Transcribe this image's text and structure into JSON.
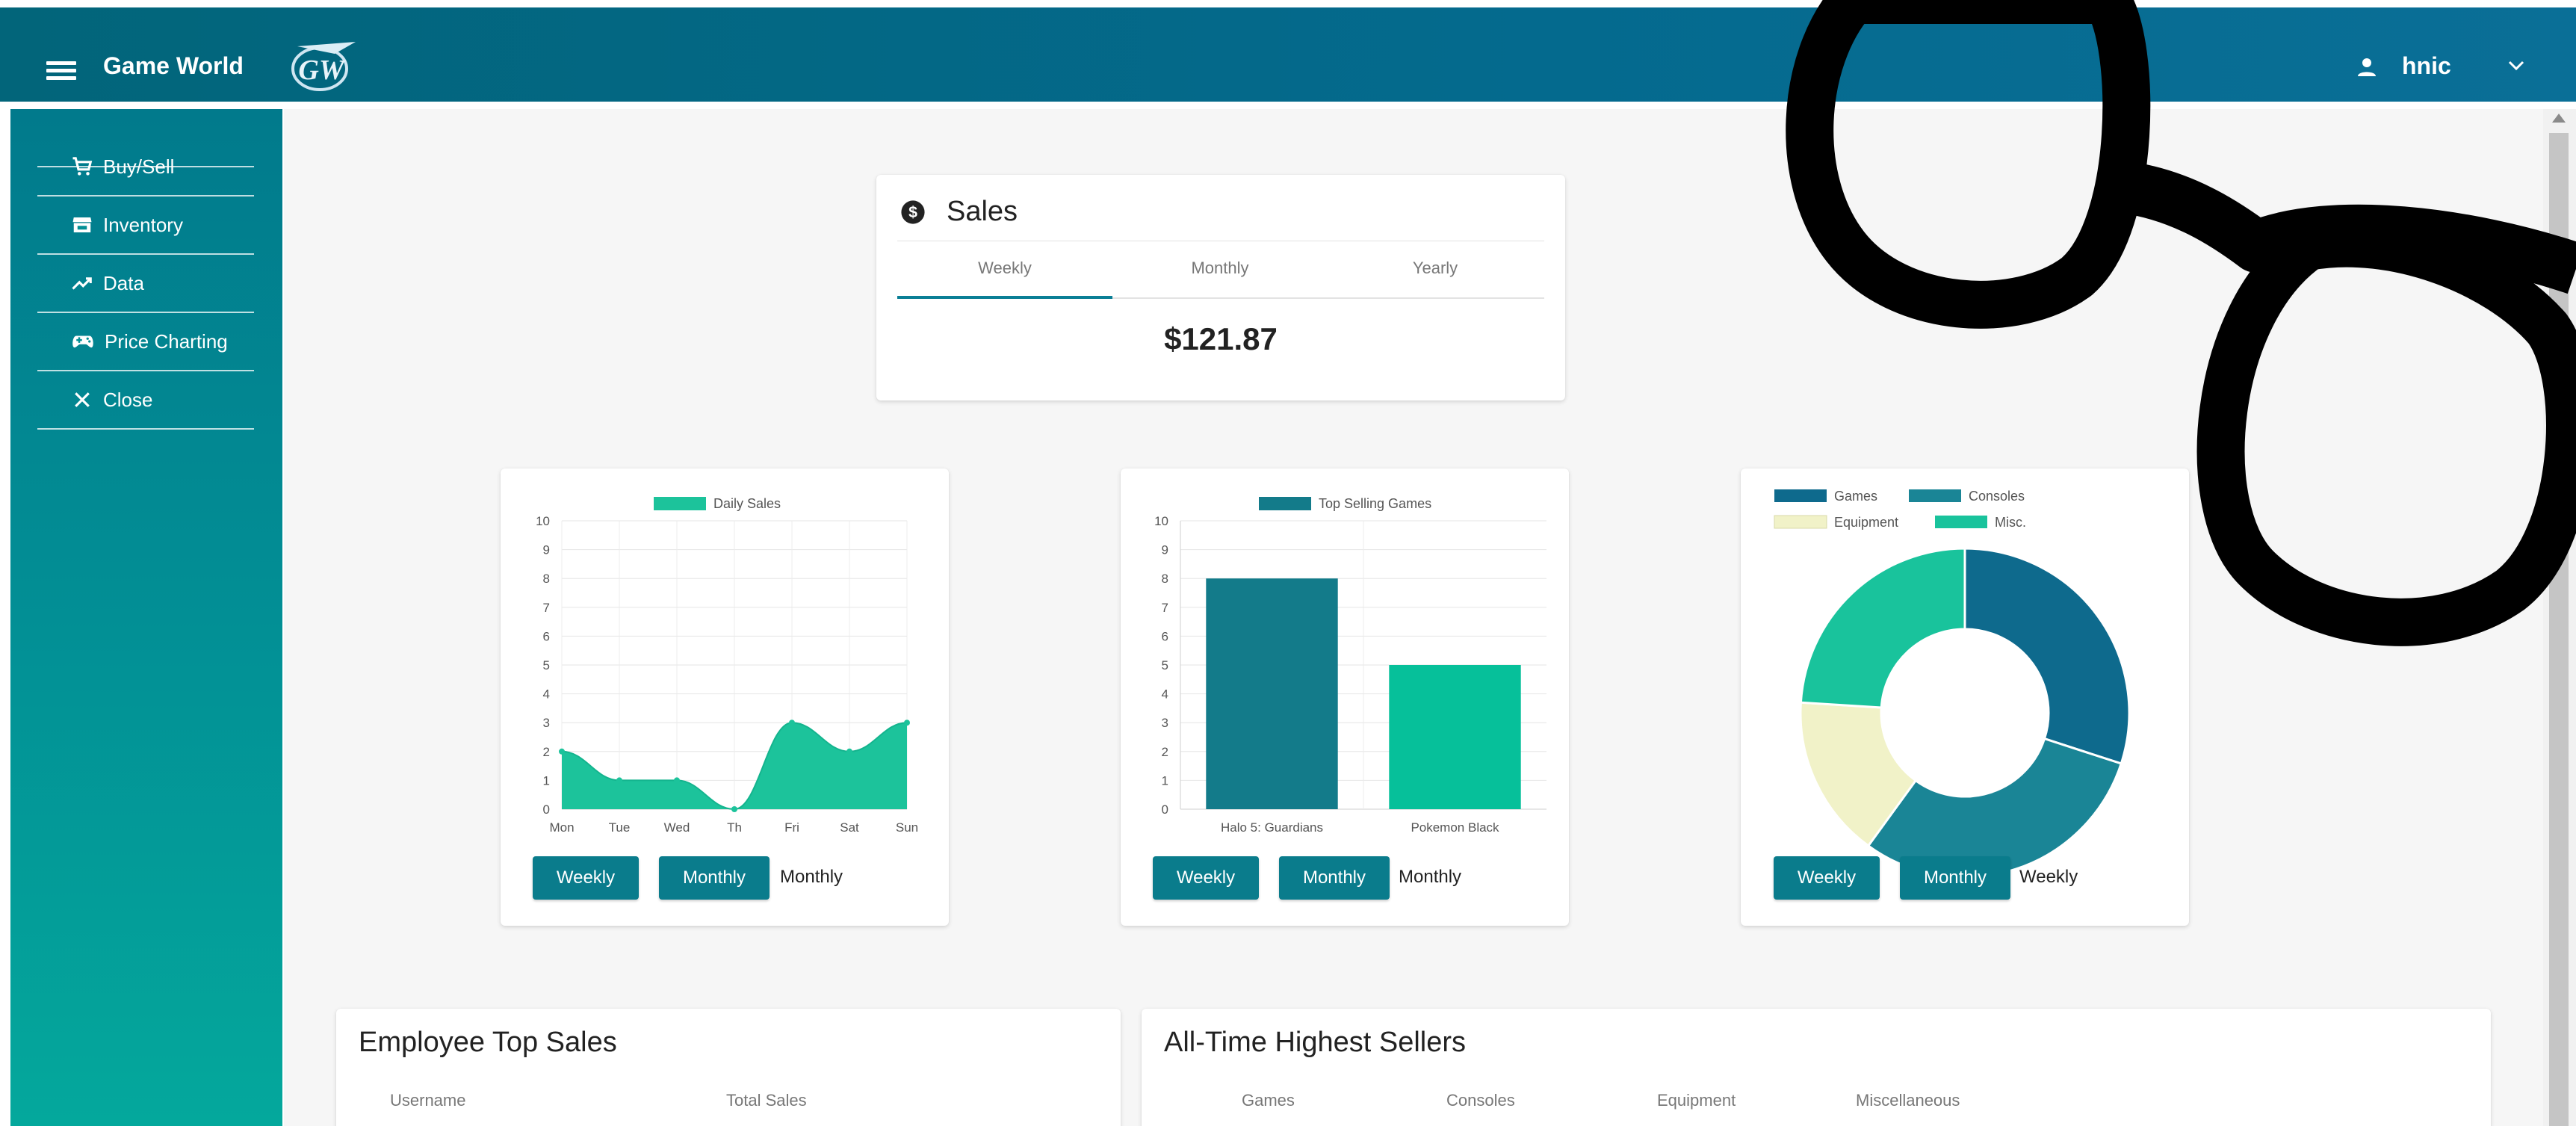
{
  "header": {
    "app_name": "Game World",
    "logo_text": "GW",
    "user_name": "hnic"
  },
  "sidebar": {
    "items": [
      {
        "label": "Buy/Sell",
        "icon": "cart-icon"
      },
      {
        "label": "Inventory",
        "icon": "store-icon"
      },
      {
        "label": "Data",
        "icon": "trending-up-icon"
      },
      {
        "label": "Price Charting",
        "icon": "gamepad-icon"
      },
      {
        "label": "Close",
        "icon": "close-icon"
      }
    ]
  },
  "sales": {
    "title": "Sales",
    "tabs": [
      "Weekly",
      "Monthly",
      "Yearly"
    ],
    "active_tab": "Weekly",
    "value": "$121.87"
  },
  "charts": {
    "daily": {
      "buttons": [
        "Weekly",
        "Monthly"
      ],
      "selected": "Monthly"
    },
    "top_games": {
      "buttons": [
        "Weekly",
        "Monthly"
      ],
      "selected": "Monthly"
    },
    "category": {
      "buttons": [
        "Weekly",
        "Monthly"
      ],
      "selected": "Weekly"
    }
  },
  "chart_data": [
    {
      "type": "area",
      "legend": [
        "Daily Sales"
      ],
      "categories": [
        "Mon",
        "Tue",
        "Wed",
        "Th",
        "Fri",
        "Sat",
        "Sun"
      ],
      "series": [
        {
          "name": "Daily Sales",
          "values": [
            2,
            1,
            1,
            0,
            3,
            2,
            3
          ]
        }
      ],
      "ylim": [
        0,
        10
      ],
      "yticks": [
        0,
        1,
        2,
        3,
        4,
        5,
        6,
        7,
        8,
        9,
        10
      ],
      "grid": true,
      "legend_position": "top",
      "color": "#1cc39b"
    },
    {
      "type": "bar",
      "legend": [
        "Top Selling Games"
      ],
      "categories": [
        "Halo 5: Guardians",
        "Pokemon Black"
      ],
      "series": [
        {
          "name": "Top Selling Games",
          "values": [
            8,
            5
          ]
        }
      ],
      "ylim": [
        0,
        10
      ],
      "yticks": [
        0,
        1,
        2,
        3,
        4,
        5,
        6,
        7,
        8,
        9,
        10
      ],
      "grid": true,
      "legend_position": "top",
      "colors": [
        "#137b8a",
        "#06c09a"
      ],
      "legend_color": "#137b8a"
    },
    {
      "type": "pie",
      "donut": true,
      "legend_position": "top",
      "categories": [
        "Games",
        "Consoles",
        "Equipment",
        "Misc."
      ],
      "values": [
        30,
        30,
        16,
        24
      ],
      "colors": [
        "#0e6a8d",
        "#1a8596",
        "#f1f2c8",
        "#19c39c"
      ]
    }
  ],
  "employee_top_sales": {
    "title": "Employee Top Sales",
    "columns": [
      "Username",
      "Total Sales"
    ]
  },
  "all_time": {
    "title": "All-Time Highest Sellers",
    "columns": [
      "Games",
      "Consoles",
      "Equipment",
      "Miscellaneous"
    ]
  }
}
